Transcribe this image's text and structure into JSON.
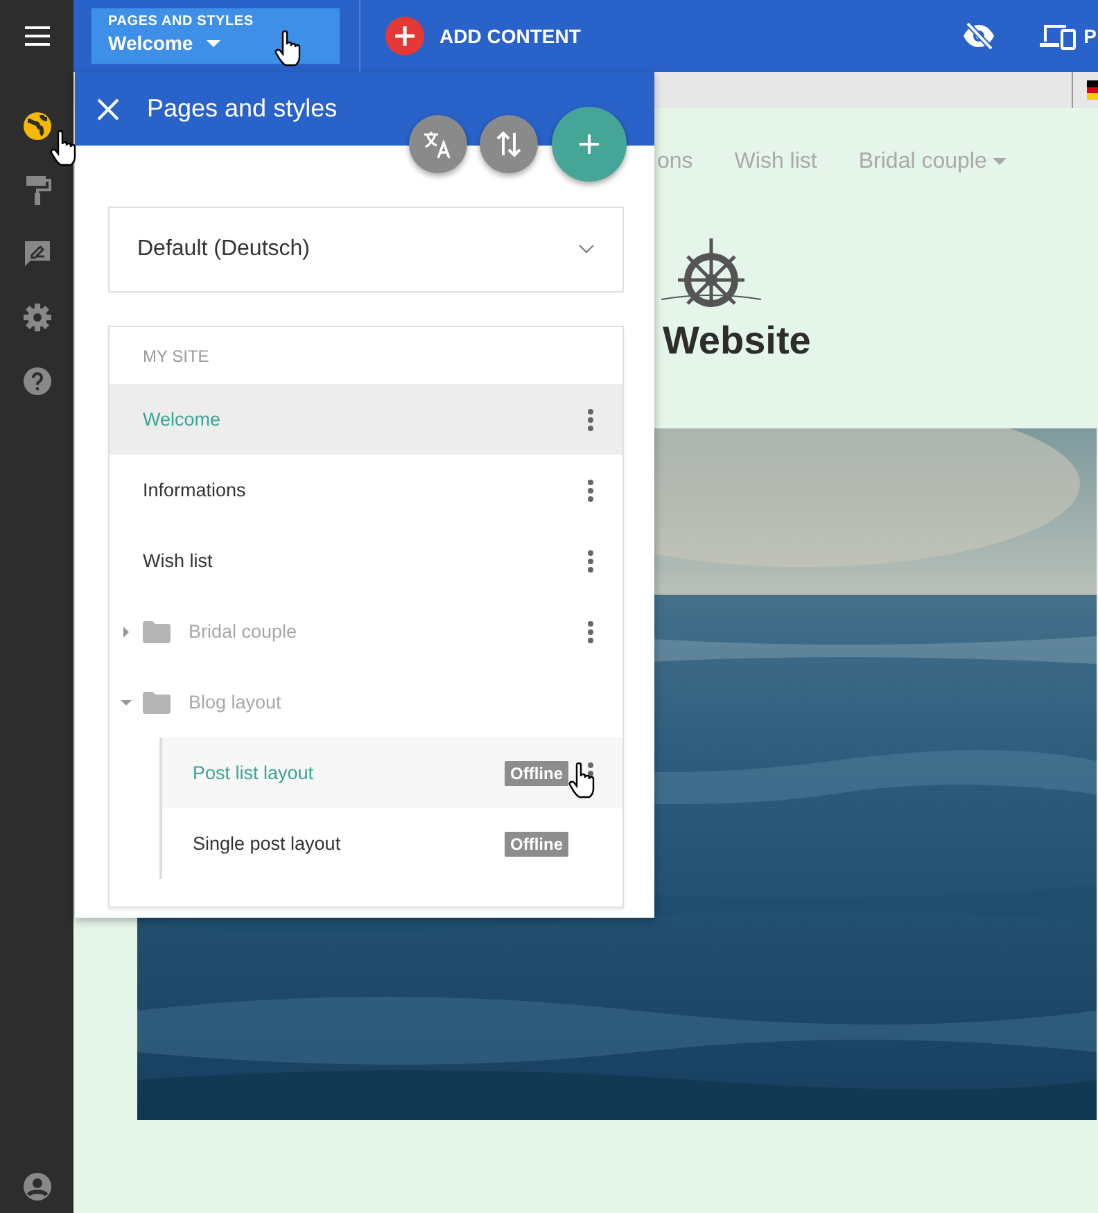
{
  "top_bar": {
    "pages_button": {
      "label": "PAGES AND STYLES",
      "value": "Welcome"
    },
    "add_content": "ADD CONTENT",
    "preview_label": "P"
  },
  "sidebar": {
    "items": [
      {
        "kind": "globe",
        "selected": true
      },
      {
        "kind": "roller",
        "selected": false
      },
      {
        "kind": "feedback",
        "selected": false
      },
      {
        "kind": "gear",
        "selected": false
      },
      {
        "kind": "help",
        "selected": false
      }
    ]
  },
  "site_preview": {
    "nav": [
      {
        "label": "ons",
        "dropdown": false
      },
      {
        "label": "Wish list",
        "dropdown": false
      },
      {
        "label": "Bridal couple",
        "dropdown": true
      }
    ],
    "title": "Website"
  },
  "panel": {
    "title": "Pages and styles",
    "language_select": "Default (Deutsch)",
    "tree": {
      "heading": "MY SITE",
      "items": [
        {
          "label": "Welcome",
          "kind": "page",
          "selected": true,
          "menu": true
        },
        {
          "label": "Informations",
          "kind": "page",
          "selected": false,
          "menu": true
        },
        {
          "label": "Wish list",
          "kind": "page",
          "selected": false,
          "menu": true
        },
        {
          "label": "Bridal couple",
          "kind": "folder",
          "selected": false,
          "menu": true,
          "expanded": false
        },
        {
          "label": "Blog layout",
          "kind": "folder",
          "selected": false,
          "menu": false,
          "expanded": true,
          "children": [
            {
              "label": "Post list layout",
              "kind": "page",
              "selected": true,
              "menu": true,
              "badge": "Offline"
            },
            {
              "label": "Single post layout",
              "kind": "page",
              "selected": false,
              "menu": false,
              "badge": "Offline"
            }
          ]
        }
      ]
    }
  }
}
